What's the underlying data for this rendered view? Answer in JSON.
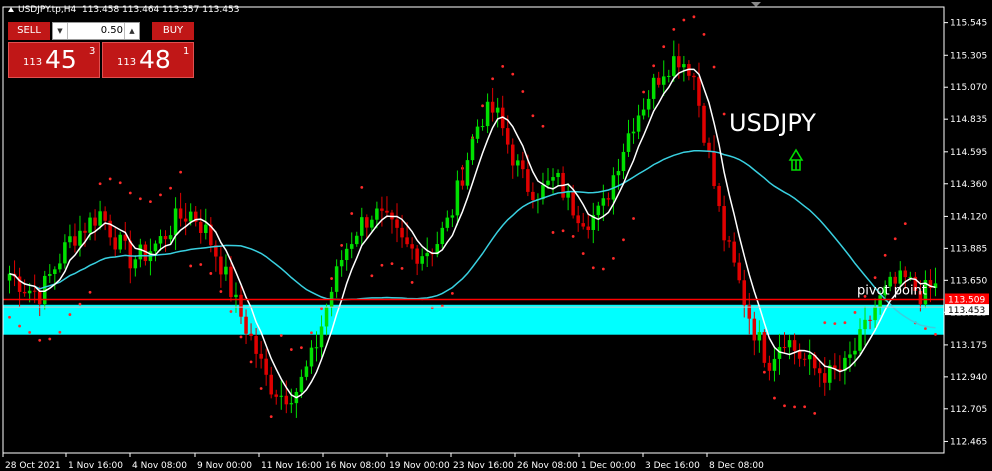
{
  "header": {
    "ticker_label": "USDJPY.tp,H4",
    "ohlc": "113.458 113.464 113.357 113.453"
  },
  "trade_panel": {
    "sell_label": "SELL",
    "buy_label": "BUY",
    "lot_value": "0.50",
    "sell_prefix": "113",
    "sell_big": "45",
    "sell_sup": "3",
    "buy_prefix": "113",
    "buy_big": "48",
    "buy_sup": "1"
  },
  "chart_data": {
    "type": "candlestick",
    "symbol_annotation": "USDJPY",
    "direction_arrow": "up-arrow",
    "pivot_label": "pivot point",
    "pivot_price": "113.509",
    "pivot_value": 113.509,
    "last_price": "113.453",
    "last_value": 113.453,
    "support_zone": [
      113.25,
      113.47
    ],
    "ylim": [
      112.38,
      115.66
    ],
    "yticks": [
      "115.545",
      "115.305",
      "115.070",
      "114.835",
      "114.595",
      "114.360",
      "114.120",
      "113.885",
      "113.650",
      "113.415",
      "113.175",
      "112.940",
      "112.705",
      "112.465"
    ],
    "ytick_values": [
      115.545,
      115.305,
      115.07,
      114.835,
      114.595,
      114.36,
      114.12,
      113.885,
      113.65,
      113.415,
      113.175,
      112.94,
      112.705,
      112.465
    ],
    "xticks": [
      "28 Oct 2021",
      "1 Nov 16:00",
      "4 Nov 08:00",
      "9 Nov 00:00",
      "11 Nov 16:00",
      "16 Nov 08:00",
      "19 Nov 00:00",
      "23 Nov 16:00",
      "26 Nov 08:00",
      "1 Dec 00:00",
      "3 Dec 16:00",
      "8 Dec 08:00"
    ],
    "close_path": [
      113.7,
      113.6,
      113.55,
      113.75,
      113.95,
      114.05,
      114.15,
      113.95,
      113.8,
      113.85,
      113.95,
      114.1,
      114.15,
      114.0,
      113.75,
      113.45,
      113.2,
      112.9,
      112.8,
      112.85,
      113.1,
      113.5,
      113.85,
      114.05,
      114.15,
      114.05,
      113.9,
      113.85,
      113.9,
      114.1,
      114.5,
      114.85,
      114.9,
      114.6,
      114.35,
      114.3,
      114.4,
      114.2,
      114.1,
      114.15,
      114.5,
      114.8,
      115.0,
      115.2,
      115.3,
      115.2,
      114.6,
      114.0,
      113.65,
      113.3,
      113.05,
      113.25,
      113.1,
      113.0,
      112.95,
      113.0,
      113.2,
      113.45,
      113.6,
      113.65,
      113.55,
      113.6
    ],
    "bull_color": "#00e000",
    "bear_color": "#e00000",
    "white_ma_color": "#ffffff",
    "cyan_ma_color": "#39d0e0",
    "zone_color": "#00ffff",
    "pivot_color": "#ff0000",
    "sar_color": "#ff2a2a",
    "arrow_color": "#00dd00"
  }
}
